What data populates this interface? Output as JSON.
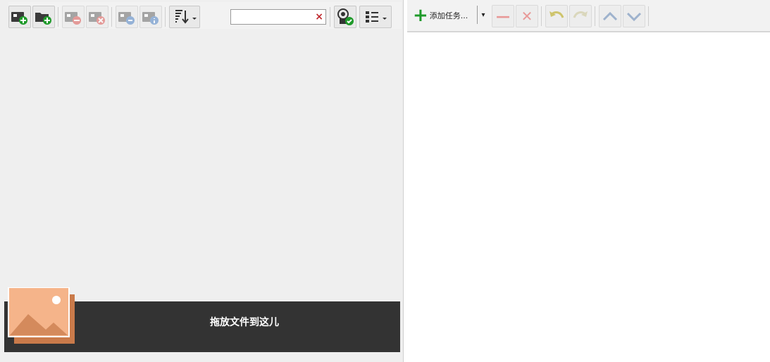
{
  "left_toolbar": {
    "buttons": [
      {
        "icon": "add-image-icon",
        "disabled": false
      },
      {
        "icon": "add-folder-icon",
        "disabled": false
      },
      {
        "icon": "remove-image-icon",
        "disabled": true
      },
      {
        "icon": "clear-images-icon",
        "disabled": true
      },
      {
        "icon": "image-settings-icon",
        "disabled": true
      },
      {
        "icon": "image-info-icon",
        "disabled": true
      },
      {
        "icon": "sort-icon",
        "disabled": false
      },
      {
        "icon": "preview-apply-icon",
        "disabled": false
      },
      {
        "icon": "view-list-icon",
        "disabled": false
      }
    ],
    "search": {
      "value": "",
      "placeholder": "",
      "clear_glyph": "×"
    }
  },
  "drop_zone": {
    "label": "拖放文件到这儿"
  },
  "right_toolbar": {
    "add_task_label": "添加任务...",
    "add_glyph": "+",
    "dropdown_glyph": "▾",
    "remove_glyph": "—",
    "clear_glyph": "✕",
    "undo_icon": "undo-icon",
    "redo_icon": "redo-icon",
    "move_up_icon": "chevron-up-icon",
    "move_down_icon": "chevron-down-icon"
  },
  "colors": {
    "accent_green": "#1f9a2a",
    "drop_zone_bg": "#333333",
    "image_icon_orange": "#f0a57a",
    "disabled_red": "#e08a8a"
  }
}
